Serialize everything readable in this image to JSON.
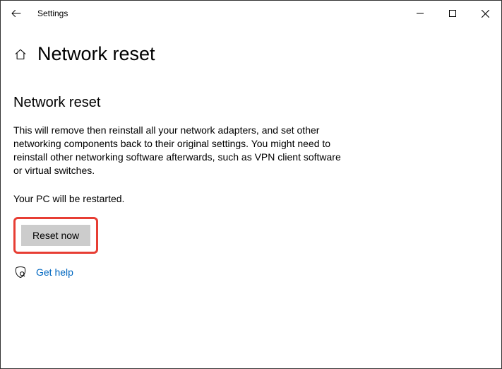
{
  "titlebar": {
    "app_title": "Settings"
  },
  "header": {
    "page_title": "Network reset"
  },
  "section": {
    "heading": "Network reset",
    "description": "This will remove then reinstall all your network adapters, and set other networking components back to their original settings. You might need to reinstall other networking software afterwards, such as VPN client software or virtual switches.",
    "restart_note": "Your PC will be restarted."
  },
  "buttons": {
    "reset_label": "Reset now"
  },
  "help": {
    "link_label": "Get help"
  }
}
